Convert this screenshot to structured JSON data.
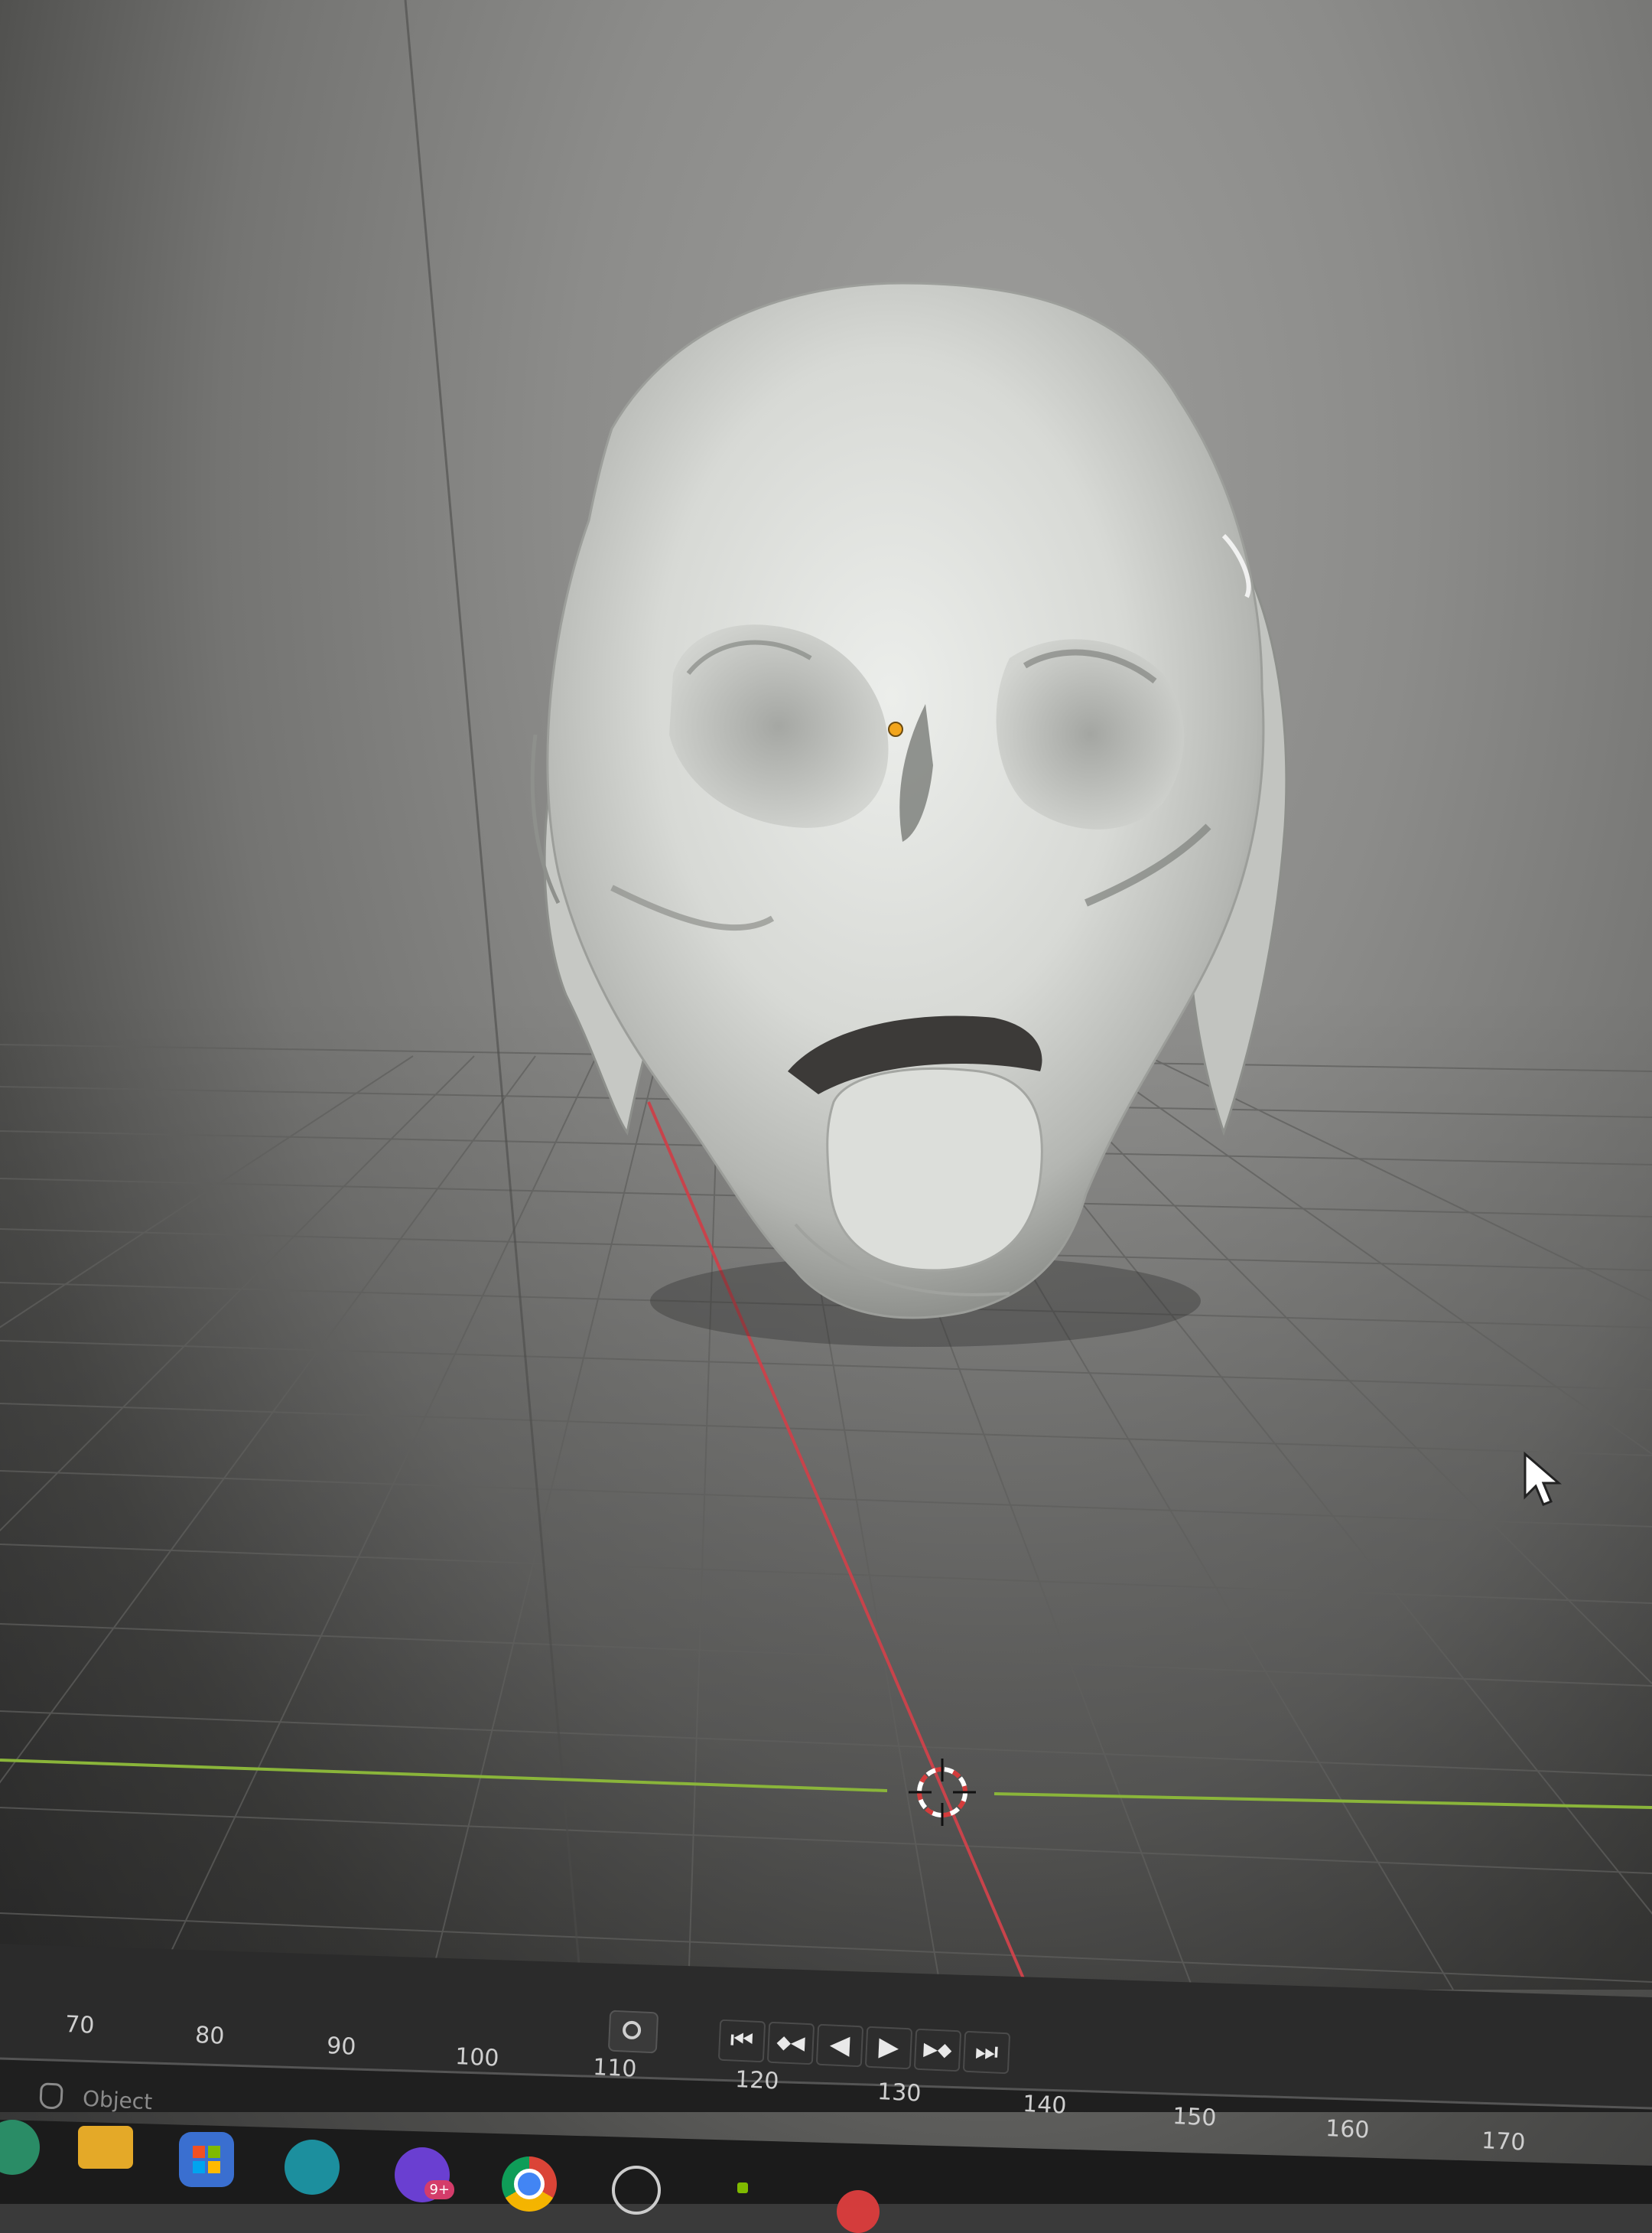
{
  "app": {
    "name": "3D viewport",
    "mode_label": "Object"
  },
  "viewport": {
    "background_color": "#8c8c8a",
    "grid_color": "#5a5a5a",
    "x_axis_color": "#c8434b",
    "y_axis_color": "#8ab53a",
    "model": "skull-like sculpted mesh",
    "model_color": "#d9dbd7",
    "origin_point_color": "#f2a51c"
  },
  "timeline": {
    "frame_ticks": [
      "70",
      "80",
      "90",
      "100",
      "110",
      "120",
      "130",
      "140",
      "150",
      "160",
      "170"
    ],
    "transport": {
      "jump_start": "⏮",
      "prev_keyframe": "◆◀",
      "play_reverse": "◀",
      "play": "▶",
      "next_keyframe": "▶◆",
      "jump_end": "⏭"
    }
  },
  "taskbar": {
    "icons": [
      "app-icon",
      "file-explorer-icon",
      "store-icon",
      "edge-icon",
      "copilot-icon",
      "chrome-icon",
      "settings-icon",
      "app-icon-2",
      "app-icon-3"
    ],
    "copilot_badge": "9+"
  }
}
